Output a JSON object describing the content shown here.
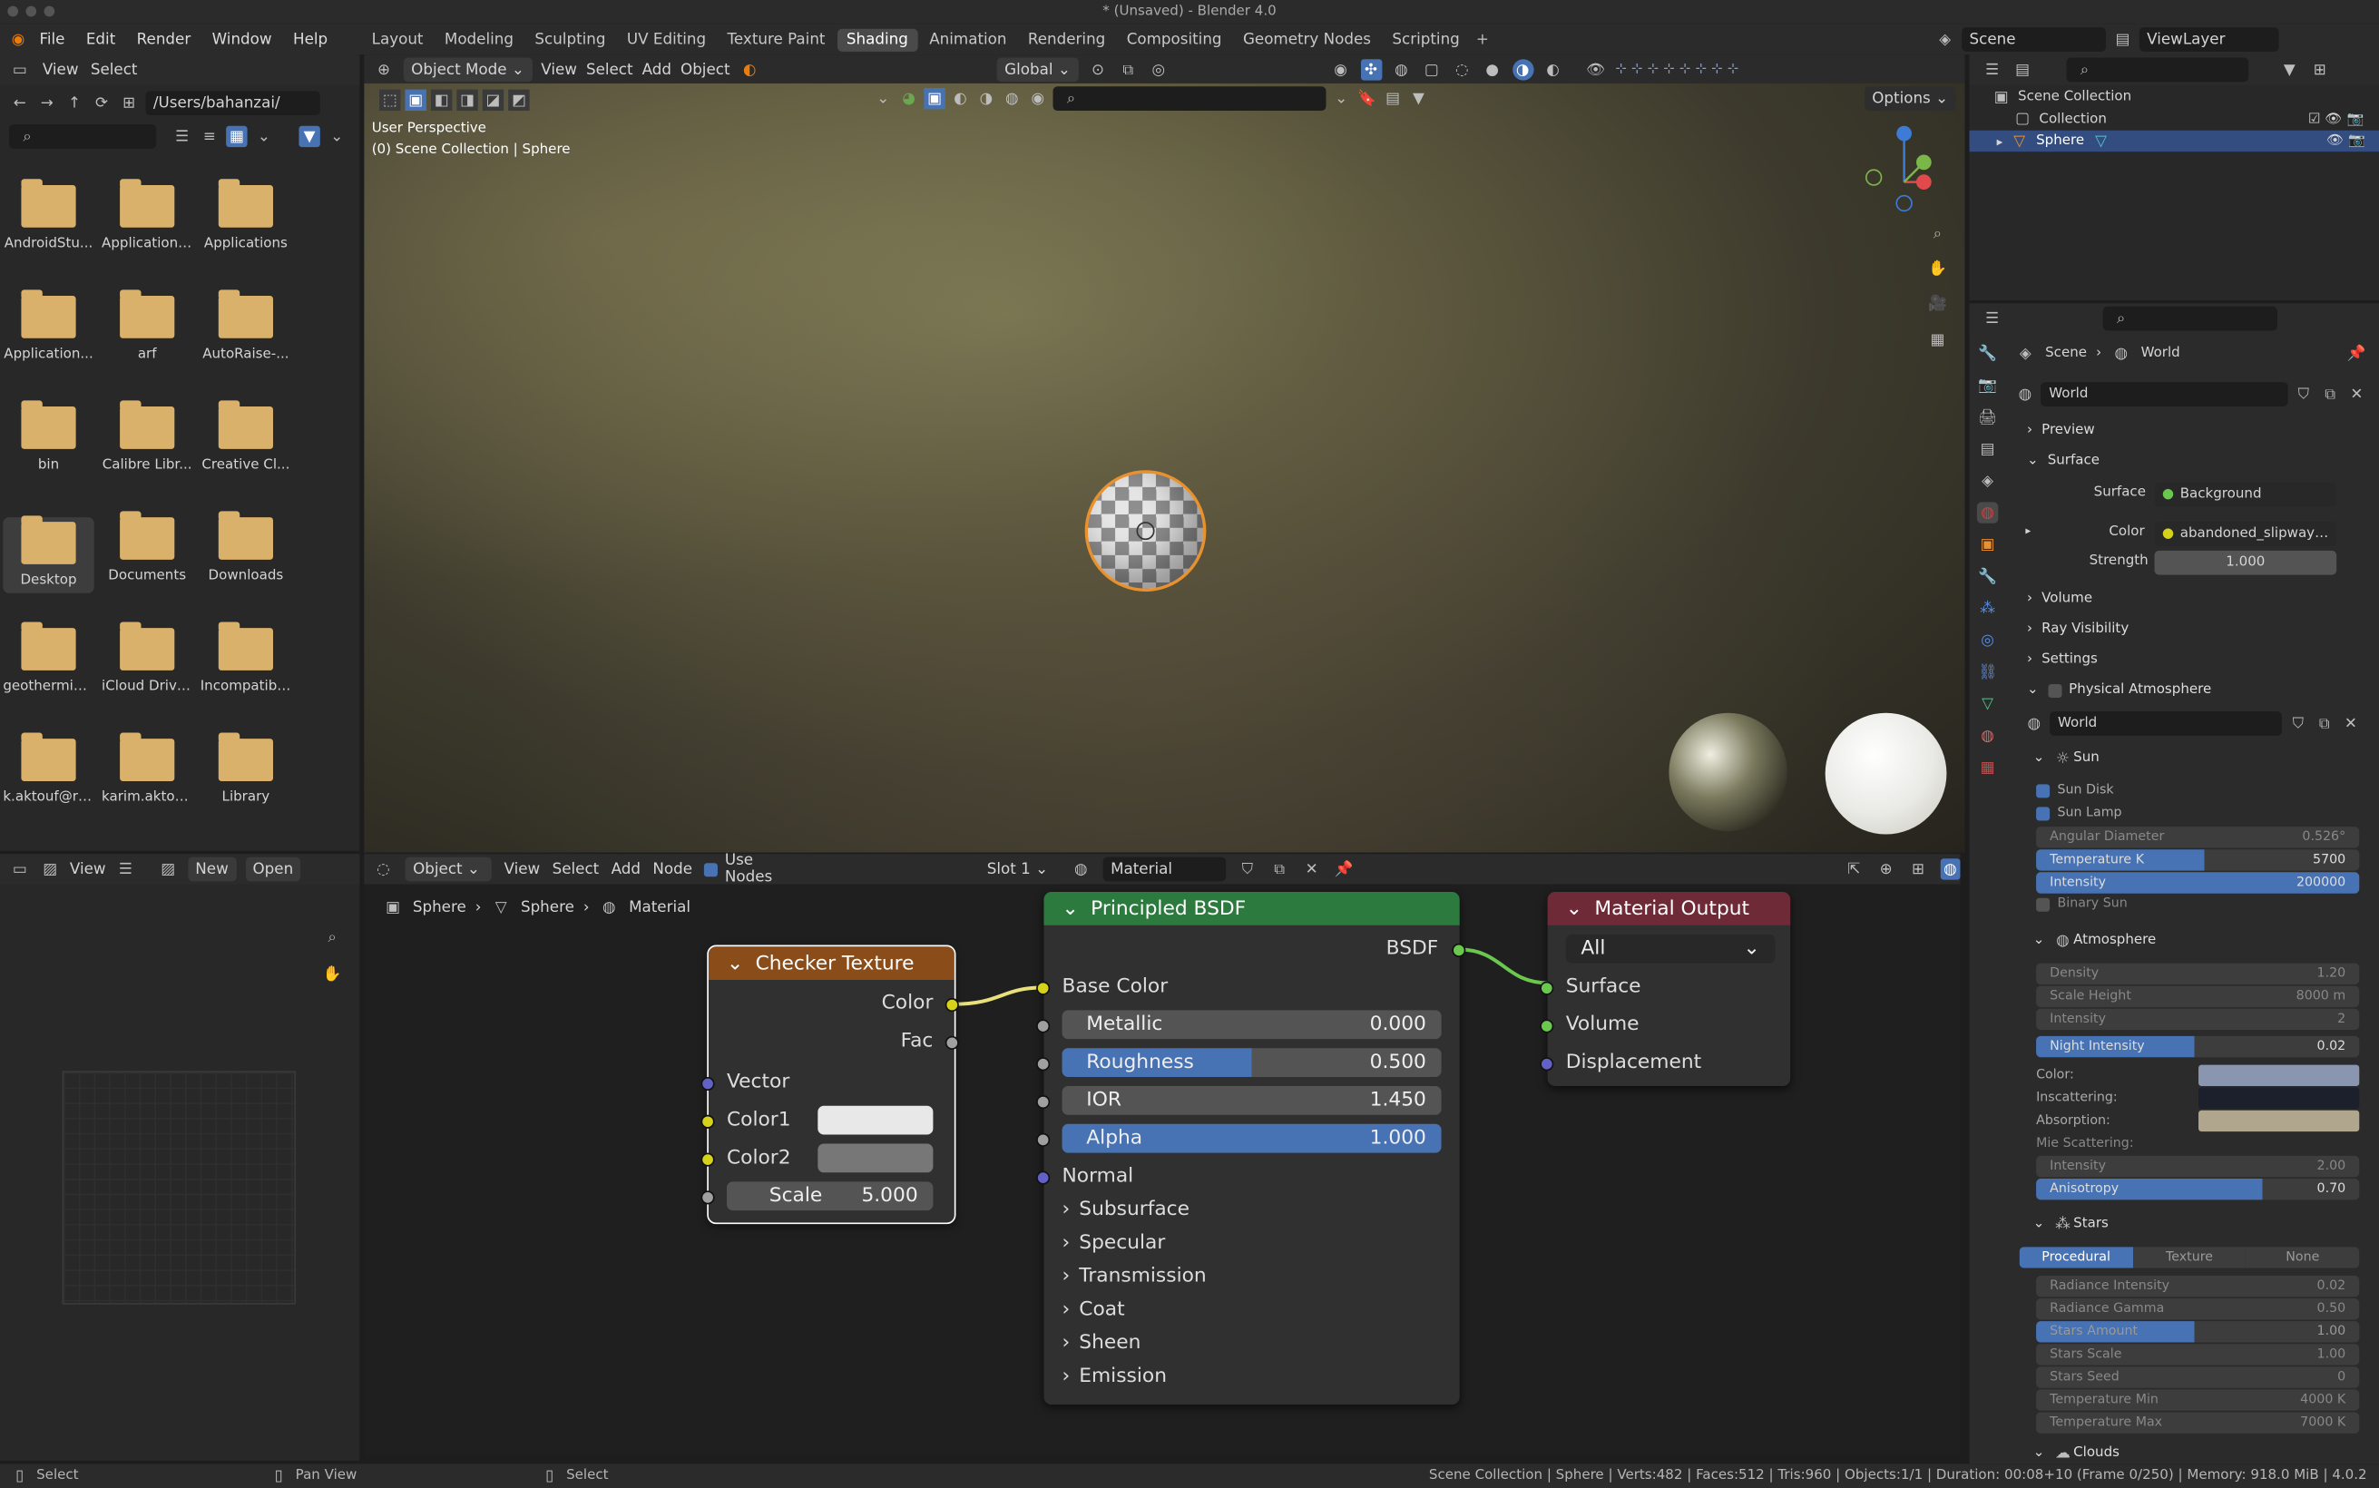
{
  "window": {
    "title": "* (Unsaved) - Blender 4.0"
  },
  "menu": {
    "items": [
      "File",
      "Edit",
      "Render",
      "Window",
      "Help"
    ]
  },
  "workspaces": [
    "Layout",
    "Modeling",
    "Sculpting",
    "UV Editing",
    "Texture Paint",
    "Shading",
    "Animation",
    "Rendering",
    "Compositing",
    "Geometry Nodes",
    "Scripting"
  ],
  "active_workspace": "Shading",
  "top_right": {
    "scene": "Scene",
    "view_layer": "ViewLayer"
  },
  "filebrowser": {
    "menu": [
      "View",
      "Select"
    ],
    "path": "/Users/bahanzai/",
    "folders": [
      "AndroidStu...",
      "Application ...",
      "Applications",
      "Application...",
      "arf",
      "AutoRaise-...",
      "bin",
      "Calibre Libr...",
      "Creative Cl...",
      "Desktop",
      "Documents",
      "Downloads",
      "geothermie...",
      "iCloud Drive...",
      "Incompatibl...",
      "k.aktouf@ru...",
      "karim.aktou...",
      "Library"
    ]
  },
  "imageeditor": {
    "view": "View",
    "new": "New",
    "open": "Open"
  },
  "viewport": {
    "mode": "Object Mode",
    "menus": [
      "View",
      "Select",
      "Add",
      "Object"
    ],
    "transform": "Global",
    "options": "Options",
    "perspective": "User Perspective",
    "collection_label": "(0) Scene Collection | Sphere"
  },
  "nodeeditor": {
    "type": "Object",
    "menus": [
      "View",
      "Select",
      "Add",
      "Node"
    ],
    "use_nodes": "Use Nodes",
    "slot": "Slot 1",
    "material": "Material",
    "breadcrumb": [
      "Sphere",
      "Sphere",
      "Material"
    ],
    "checker": {
      "title": "Checker Texture",
      "out_color": "Color",
      "out_fac": "Fac",
      "vector": "Vector",
      "color1": "Color1",
      "color2": "Color2",
      "scale_label": "Scale",
      "scale": "5.000",
      "color1_hex": "#e8e8e8",
      "color2_hex": "#777777"
    },
    "bsdf": {
      "title": "Principled BSDF",
      "out": "BSDF",
      "base_color": "Base Color",
      "metallic_label": "Metallic",
      "metallic": "0.000",
      "roughness_label": "Roughness",
      "roughness": "0.500",
      "roughness_fill": 0.5,
      "ior_label": "IOR",
      "ior": "1.450",
      "alpha_label": "Alpha",
      "alpha": "1.000",
      "alpha_fill": 1.0,
      "normal": "Normal",
      "panels": [
        "Subsurface",
        "Specular",
        "Transmission",
        "Coat",
        "Sheen",
        "Emission"
      ]
    },
    "output": {
      "title": "Material Output",
      "target": "All",
      "surface": "Surface",
      "volume": "Volume",
      "displacement": "Displacement"
    }
  },
  "outliner": {
    "root": "Scene Collection",
    "collection": "Collection",
    "object": "Sphere"
  },
  "properties": {
    "breadcrumb": [
      "Scene",
      "World"
    ],
    "world": "World",
    "sections": {
      "preview": "Preview",
      "surface": "Surface",
      "volume": "Volume",
      "ray_visibility": "Ray Visibility",
      "settings": "Settings",
      "phys": "Physical Atmosphere"
    },
    "surface_label": "Surface",
    "surface_value": "Background",
    "color_label": "Color",
    "color_value": "abandoned_slipway_4k....",
    "strength_label": "Strength",
    "strength": "1.000",
    "pa_world": "World",
    "sun": "Sun",
    "sun_disk": "Sun Disk",
    "sun_lamp": "Sun Lamp",
    "angular_label": "Angular Diameter",
    "angular": "0.526°",
    "temp_label": "Temperature K",
    "temp": "5700",
    "temp_fill": 0.52,
    "intensity_label": "Intensity",
    "intensity": "200000",
    "binary_sun": "Binary Sun",
    "atmosphere": "Atmosphere",
    "density_label": "Density",
    "density": "1.20",
    "scale_h_label": "Scale Height",
    "scale_h": "8000 m",
    "a_int_label": "Intensity",
    "a_int": "2",
    "night_label": "Night Intensity",
    "night": "0.02",
    "night_fill": 0.49,
    "color_l": "Color:",
    "inscat_l": "Inscattering:",
    "absorp_l": "Absorption:",
    "mie_l": "Mie Scattering:",
    "mie_int_label": "Intensity",
    "mie_int": "2.00",
    "aniso_label": "Anisotropy",
    "aniso": "0.70",
    "aniso_fill": 0.7,
    "color_hex": "#8a96b0",
    "inscat_hex": "#1c1f2c",
    "absorp_hex": "#b0a68e",
    "stars": "Stars",
    "stars_tabs": [
      "Procedural",
      "Texture",
      "None"
    ],
    "rad_int_label": "Radiance Intensity",
    "rad_int": "0.02",
    "rad_gamma_label": "Radiance Gamma",
    "rad_gamma": "0.50",
    "stars_amt_label": "Stars Amount",
    "stars_amt": "1.00",
    "stars_amt_fill": 0.49,
    "stars_scale_label": "Stars Scale",
    "stars_scale": "1.00",
    "stars_seed_label": "Stars Seed",
    "stars_seed": "0",
    "tmin_label": "Temperature Min",
    "tmin": "4000 K",
    "tmax_label": "Temperature Max",
    "tmax": "7000 K",
    "clouds": "Clouds"
  },
  "status": {
    "left": "Select",
    "mid": "Pan View",
    "mid2": "Select",
    "info": "Scene Collection | Sphere | Verts:482 | Faces:512 | Tris:960 | Objects:1/1 | Duration: 00:08+10 (Frame 0/250) | Memory: 918.0 MiB | 4.0.2"
  }
}
